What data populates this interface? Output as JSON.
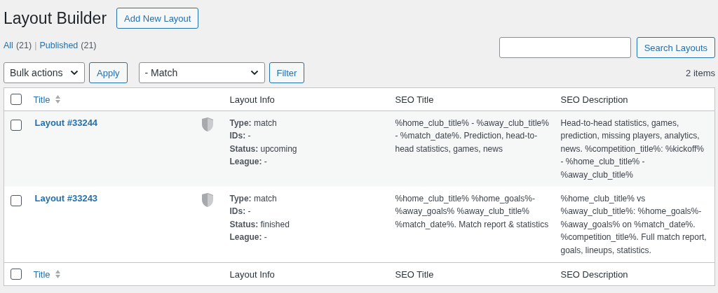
{
  "page_title": "Layout Builder",
  "add_button": "Add New Layout",
  "views": [
    {
      "label": "All",
      "count": "(21)",
      "selected": false
    },
    {
      "separator": "|",
      "label": "Published",
      "count": "(21)",
      "selected": false
    }
  ],
  "search": {
    "button": "Search Layouts"
  },
  "bulk_actions": {
    "value": "Bulk actions",
    "button": "Apply"
  },
  "filter": {
    "value": "- Match",
    "button": "Filter"
  },
  "item_count": "2 items",
  "table": {
    "columns": [
      "Title",
      "Layout Info",
      "SEO Title",
      "SEO Description"
    ],
    "rows": [
      {
        "checked": false,
        "title": "Layout #33244",
        "info": [
          "**Type:** match",
          "**IDs:** -",
          "**Status:** upcoming",
          "**League:** -"
        ],
        "seo_title": "%home_club_title% - %away_club_title% - %match_date%. Prediction, head-to-head statistics, games, news",
        "seo_description": "Head-to-head statistics, games, prediction, missing players, analytics, news. %competition_title%: %kickoff% - %home_club_title% - %away_club_title%"
      },
      {
        "checked": false,
        "title": "Layout #33243",
        "info": [
          "**Type:** match",
          "**IDs:** -",
          "**Status:** finished",
          "**League:** -"
        ],
        "seo_title": "%home_club_title% %home_goals%-%away_goals% %away_club_title% %match_date%. Match report & statistics",
        "seo_description": "%home_club_title% vs %away_club_title%: %home_goals%-%away_goals% on %match_date%. %competition_title%. Full match report, goals, lineups, statistics."
      }
    ],
    "footer_columns": [
      "Title",
      "Layout Info",
      "SEO Title",
      "SEO Description"
    ],
    "header_checked": false,
    "footer_checked": false
  }
}
